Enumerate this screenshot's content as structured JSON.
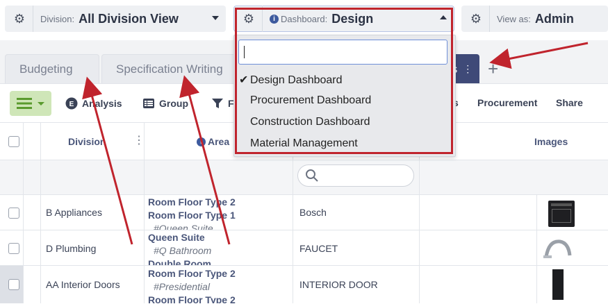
{
  "top": {
    "division": {
      "label": "Division:",
      "value": "All Division View"
    },
    "dashboard": {
      "label": "Dashboard:",
      "value": "Design"
    },
    "view_as": {
      "label": "View as:",
      "value": "Admin"
    }
  },
  "tabs": [
    {
      "label": "Budgeting"
    },
    {
      "label": "Specification Writing"
    },
    {
      "label": "s"
    }
  ],
  "toolbar": {
    "analysis": "Analysis",
    "group": "Group",
    "filter": "F",
    "s_item": "s",
    "procurement": "Procurement",
    "share": "Share"
  },
  "grid": {
    "headers": {
      "division": "Division",
      "area": "Area",
      "images": "Images"
    },
    "rows": [
      {
        "division": "B Appliances",
        "area": [
          "Room Floor Type 2",
          "Room Floor Type 1",
          "#Queen Suite"
        ],
        "item": "Bosch"
      },
      {
        "division": "D Plumbing",
        "area": [
          "Queen Suite",
          "#Q Bathroom",
          "Double Room"
        ],
        "item": "FAUCET"
      },
      {
        "division": "AA Interior Doors",
        "area": [
          "Room Floor Type 2",
          "#Presidential",
          "Room Floor Type 2"
        ],
        "item": "INTERIOR DOOR"
      }
    ]
  },
  "dropdown": {
    "search_value": "",
    "options": [
      {
        "label": "Design Dashboard",
        "checked": true
      },
      {
        "label": "Procurement Dashboard",
        "checked": false
      },
      {
        "label": "Construction Dashboard",
        "checked": false
      },
      {
        "label": "Material Management",
        "checked": false
      }
    ]
  },
  "colors": {
    "accent_tab": "#3f4a78",
    "annotation_red": "#c0242d",
    "menu_green": "#cfe6b8"
  }
}
